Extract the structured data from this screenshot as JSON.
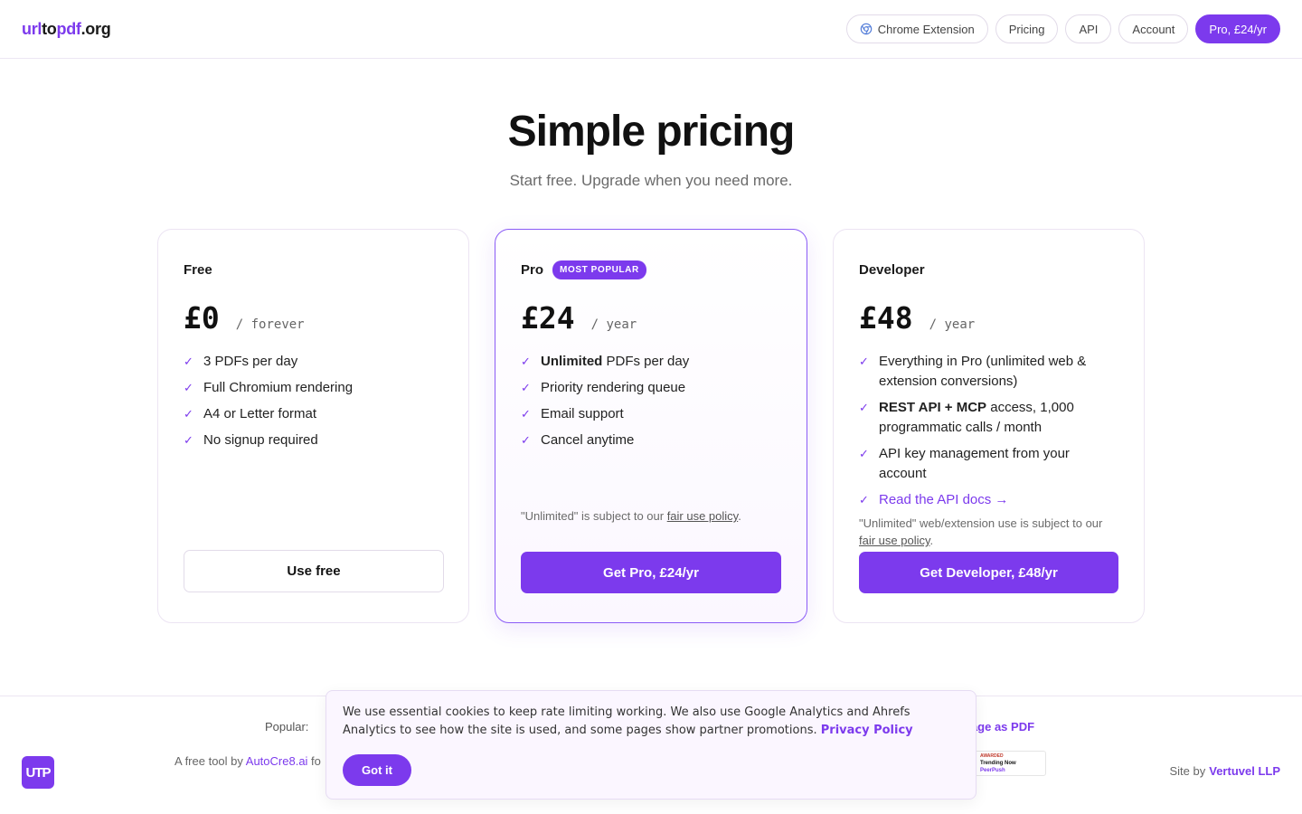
{
  "header": {
    "logo": {
      "part1": "url",
      "part2": "to",
      "part3": "pdf",
      "part4": ".org"
    },
    "nav": {
      "chrome_extension": "Chrome Extension",
      "pricing": "Pricing",
      "api": "API",
      "account": "Account",
      "pro": "Pro, £24/yr"
    }
  },
  "hero": {
    "title": "Simple pricing",
    "subtitle": "Start free. Upgrade when you need more."
  },
  "plans": [
    {
      "name": "Free",
      "price": "£0",
      "period": "/ forever",
      "features": [
        "3 PDFs per day",
        "Full Chromium rendering",
        "A4 or Letter format",
        "No signup required"
      ],
      "button": "Use free"
    },
    {
      "name": "Pro",
      "badge": "MOST POPULAR",
      "price": "£24",
      "period": "/ year",
      "features": [
        {
          "bold": "Unlimited",
          "text": " PDFs per day"
        },
        "Priority rendering queue",
        "Email support",
        "Cancel anytime"
      ],
      "fineprint": {
        "before": "\"Unlimited\" is subject to our ",
        "link": "fair use policy",
        "after": "."
      },
      "button": "Get Pro, £24/yr"
    },
    {
      "name": "Developer",
      "price": "£48",
      "period": "/ year",
      "features": [
        "Everything in Pro (unlimited web & extension conversions)",
        {
          "bold": "REST API + MCP",
          "text": " access, 1,000 programmatic calls / month"
        },
        "API key management from your account",
        {
          "link": "Read the API docs →"
        }
      ],
      "fineprint": {
        "before": "\"Unlimited\" web/extension use is subject to our ",
        "link": "fair use policy",
        "after": "."
      },
      "button": "Get Developer, £48/yr"
    }
  ],
  "footer": {
    "popular_label": "Popular:",
    "popular_link_visible": "page as PDF",
    "logo_text": "UTP",
    "credit_prefix": "A free tool by ",
    "credit_link": "AutoCre8.ai",
    "credit_suffix": " fo",
    "award": {
      "line1": "AWARDED",
      "line2": "Trending Now",
      "line3": "PeerPush"
    },
    "siteby_label": "Site by",
    "siteby_link": "Vertuvel LLP"
  },
  "cookie": {
    "text": "We use essential cookies to keep rate limiting working. We also use Google Analytics and Ahrefs Analytics to see how the site is used, and some pages show partner promotions. ",
    "link": "Privacy Policy",
    "button": "Got it"
  },
  "colors": {
    "accent": "#7c3aed",
    "border": "#ece4f3"
  },
  "icons": {
    "check": "check-icon",
    "chrome": "chrome-icon"
  }
}
